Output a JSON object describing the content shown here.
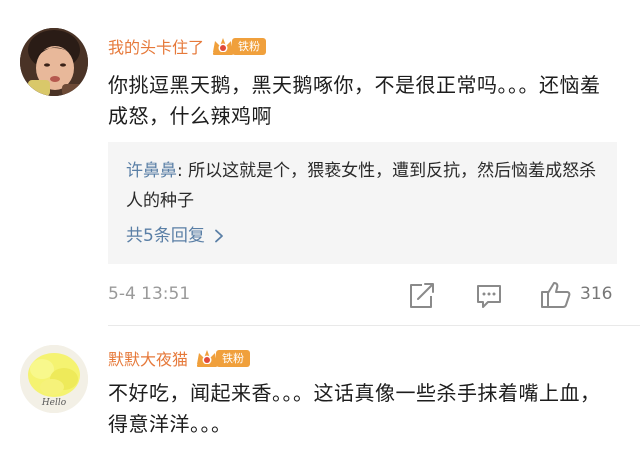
{
  "comments": [
    {
      "username": "我的头卡住了",
      "badge": "铁粉",
      "avatar_icon": "child-photo-avatar",
      "text": "你挑逗黑天鹅，黑天鹅啄你，不是很正常吗。。。还恼羞成怒，什么辣鸡啊",
      "reply": {
        "author": "许鼻鼻",
        "separator": ": ",
        "text": "所以这就是个，猥亵女性，遭到反抗，然后恼羞成怒杀人的种子",
        "more_label": "共5条回复"
      },
      "timestamp": "5-4 13:51",
      "likes": "316"
    },
    {
      "username": "默默大夜猫",
      "badge": "铁粉",
      "avatar_icon": "mosaic-avatar",
      "avatar_text": "Hello",
      "text": "不好吃，闻起来香。。。这话真像一些杀手抹着嘴上血，得意洋洋。。。"
    }
  ],
  "colors": {
    "username": "#e6793a",
    "badge_bg": "#f0a03c",
    "reply_link": "#5a7fa6",
    "reply_bg": "#f5f5f5",
    "meta_gray": "#9a9a9a"
  }
}
